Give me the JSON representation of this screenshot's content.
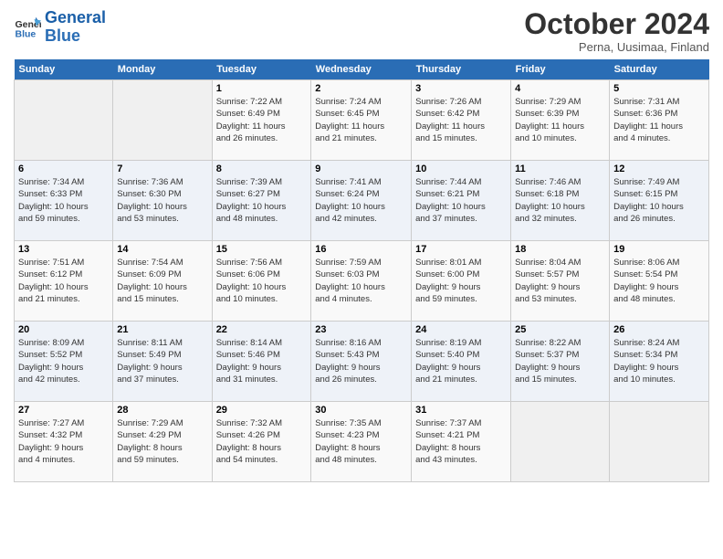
{
  "header": {
    "logo_line1": "General",
    "logo_line2": "Blue",
    "month": "October 2024",
    "location": "Perna, Uusimaa, Finland"
  },
  "weekdays": [
    "Sunday",
    "Monday",
    "Tuesday",
    "Wednesday",
    "Thursday",
    "Friday",
    "Saturday"
  ],
  "weeks": [
    [
      {
        "day": "",
        "info": ""
      },
      {
        "day": "",
        "info": ""
      },
      {
        "day": "1",
        "info": "Sunrise: 7:22 AM\nSunset: 6:49 PM\nDaylight: 11 hours\nand 26 minutes."
      },
      {
        "day": "2",
        "info": "Sunrise: 7:24 AM\nSunset: 6:45 PM\nDaylight: 11 hours\nand 21 minutes."
      },
      {
        "day": "3",
        "info": "Sunrise: 7:26 AM\nSunset: 6:42 PM\nDaylight: 11 hours\nand 15 minutes."
      },
      {
        "day": "4",
        "info": "Sunrise: 7:29 AM\nSunset: 6:39 PM\nDaylight: 11 hours\nand 10 minutes."
      },
      {
        "day": "5",
        "info": "Sunrise: 7:31 AM\nSunset: 6:36 PM\nDaylight: 11 hours\nand 4 minutes."
      }
    ],
    [
      {
        "day": "6",
        "info": "Sunrise: 7:34 AM\nSunset: 6:33 PM\nDaylight: 10 hours\nand 59 minutes."
      },
      {
        "day": "7",
        "info": "Sunrise: 7:36 AM\nSunset: 6:30 PM\nDaylight: 10 hours\nand 53 minutes."
      },
      {
        "day": "8",
        "info": "Sunrise: 7:39 AM\nSunset: 6:27 PM\nDaylight: 10 hours\nand 48 minutes."
      },
      {
        "day": "9",
        "info": "Sunrise: 7:41 AM\nSunset: 6:24 PM\nDaylight: 10 hours\nand 42 minutes."
      },
      {
        "day": "10",
        "info": "Sunrise: 7:44 AM\nSunset: 6:21 PM\nDaylight: 10 hours\nand 37 minutes."
      },
      {
        "day": "11",
        "info": "Sunrise: 7:46 AM\nSunset: 6:18 PM\nDaylight: 10 hours\nand 32 minutes."
      },
      {
        "day": "12",
        "info": "Sunrise: 7:49 AM\nSunset: 6:15 PM\nDaylight: 10 hours\nand 26 minutes."
      }
    ],
    [
      {
        "day": "13",
        "info": "Sunrise: 7:51 AM\nSunset: 6:12 PM\nDaylight: 10 hours\nand 21 minutes."
      },
      {
        "day": "14",
        "info": "Sunrise: 7:54 AM\nSunset: 6:09 PM\nDaylight: 10 hours\nand 15 minutes."
      },
      {
        "day": "15",
        "info": "Sunrise: 7:56 AM\nSunset: 6:06 PM\nDaylight: 10 hours\nand 10 minutes."
      },
      {
        "day": "16",
        "info": "Sunrise: 7:59 AM\nSunset: 6:03 PM\nDaylight: 10 hours\nand 4 minutes."
      },
      {
        "day": "17",
        "info": "Sunrise: 8:01 AM\nSunset: 6:00 PM\nDaylight: 9 hours\nand 59 minutes."
      },
      {
        "day": "18",
        "info": "Sunrise: 8:04 AM\nSunset: 5:57 PM\nDaylight: 9 hours\nand 53 minutes."
      },
      {
        "day": "19",
        "info": "Sunrise: 8:06 AM\nSunset: 5:54 PM\nDaylight: 9 hours\nand 48 minutes."
      }
    ],
    [
      {
        "day": "20",
        "info": "Sunrise: 8:09 AM\nSunset: 5:52 PM\nDaylight: 9 hours\nand 42 minutes."
      },
      {
        "day": "21",
        "info": "Sunrise: 8:11 AM\nSunset: 5:49 PM\nDaylight: 9 hours\nand 37 minutes."
      },
      {
        "day": "22",
        "info": "Sunrise: 8:14 AM\nSunset: 5:46 PM\nDaylight: 9 hours\nand 31 minutes."
      },
      {
        "day": "23",
        "info": "Sunrise: 8:16 AM\nSunset: 5:43 PM\nDaylight: 9 hours\nand 26 minutes."
      },
      {
        "day": "24",
        "info": "Sunrise: 8:19 AM\nSunset: 5:40 PM\nDaylight: 9 hours\nand 21 minutes."
      },
      {
        "day": "25",
        "info": "Sunrise: 8:22 AM\nSunset: 5:37 PM\nDaylight: 9 hours\nand 15 minutes."
      },
      {
        "day": "26",
        "info": "Sunrise: 8:24 AM\nSunset: 5:34 PM\nDaylight: 9 hours\nand 10 minutes."
      }
    ],
    [
      {
        "day": "27",
        "info": "Sunrise: 7:27 AM\nSunset: 4:32 PM\nDaylight: 9 hours\nand 4 minutes."
      },
      {
        "day": "28",
        "info": "Sunrise: 7:29 AM\nSunset: 4:29 PM\nDaylight: 8 hours\nand 59 minutes."
      },
      {
        "day": "29",
        "info": "Sunrise: 7:32 AM\nSunset: 4:26 PM\nDaylight: 8 hours\nand 54 minutes."
      },
      {
        "day": "30",
        "info": "Sunrise: 7:35 AM\nSunset: 4:23 PM\nDaylight: 8 hours\nand 48 minutes."
      },
      {
        "day": "31",
        "info": "Sunrise: 7:37 AM\nSunset: 4:21 PM\nDaylight: 8 hours\nand 43 minutes."
      },
      {
        "day": "",
        "info": ""
      },
      {
        "day": "",
        "info": ""
      }
    ]
  ]
}
